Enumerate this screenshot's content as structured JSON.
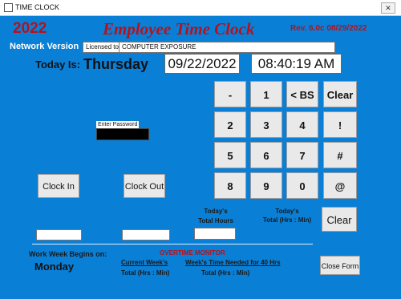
{
  "window": {
    "title": "TIME CLOCK",
    "close_glyph": "✕"
  },
  "header": {
    "year": "2022",
    "app_title": "Employee Time Clock",
    "revision": "Rev. 6.0c 08/29/2022",
    "network_version": "Network Version",
    "licensed_to_label": "Licensed to",
    "licensed_to_value": "COMPUTER EXPOSURE"
  },
  "today": {
    "label": "Today Is:",
    "day": "Thursday",
    "date": "09/22/2022",
    "time": "08:40:19 AM"
  },
  "keypad": {
    "row1": [
      "-",
      "1",
      "< BS",
      "Clear"
    ],
    "row2": [
      "2",
      "3",
      "4",
      "!"
    ],
    "row3": [
      "5",
      "6",
      "7",
      "#"
    ],
    "row4": [
      "8",
      "9",
      "0",
      "@"
    ]
  },
  "password": {
    "label": "Enter Password"
  },
  "buttons": {
    "clock_in": "Clock In",
    "clock_out": "Clock Out",
    "clear": "Clear",
    "close_form": "Close Form"
  },
  "totals": {
    "todays_total_hours_1": "Today's",
    "todays_total_hours_2": "Total Hours",
    "todays_total_hm_1": "Today's",
    "todays_total_hm_2": "Total (Hrs : Min)"
  },
  "overtime": {
    "monitor_label": "OVERTIME MONITOR",
    "work_week_label": "Work Week Begins on:",
    "work_week_day": "Monday",
    "current_week_1": "Current Week's",
    "current_week_2": "Total (Hrs : Min)",
    "time_needed_1": "Week's Time Needed for 40 Hrs",
    "time_needed_2": "Total (Hrs : Min)"
  },
  "colors": {
    "background": "#0a7fd6",
    "accent": "#b5121b"
  }
}
